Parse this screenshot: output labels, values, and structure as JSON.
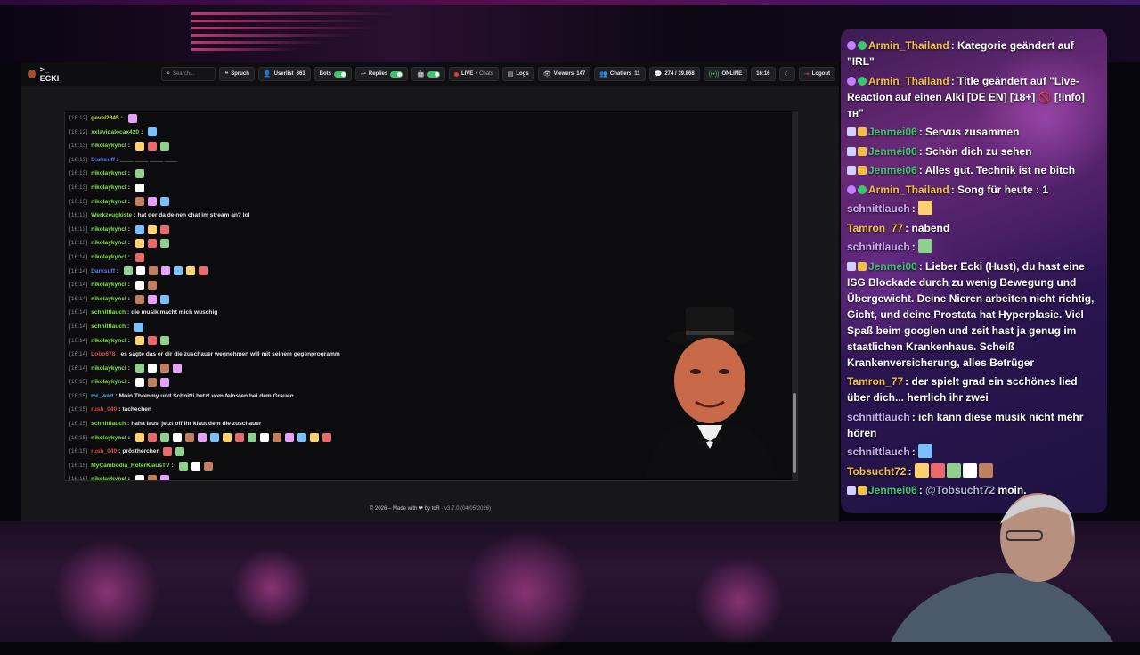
{
  "app": {
    "brand": ">_ ECKI",
    "search_placeholder": "Search...",
    "toolbar": [
      {
        "icon": "quote-icon",
        "label": "Spruch",
        "value": ""
      },
      {
        "icon": "user-icon",
        "label": "Userlist",
        "value": "363"
      },
      {
        "icon": "",
        "label": "Bots",
        "value": "",
        "toggle": true
      },
      {
        "icon": "reply-icon",
        "label": "Replies",
        "value": "",
        "toggle": true
      },
      {
        "icon": "bot-icon",
        "label": "",
        "value": "",
        "toggle": true
      },
      {
        "icon": "live-dot",
        "label": "LIVE",
        "value": "• Chats"
      },
      {
        "icon": "logs-icon",
        "label": "Logs",
        "value": ""
      },
      {
        "icon": "eye-icon",
        "label": "Viewers",
        "value": "147"
      },
      {
        "icon": "users-icon",
        "label": "Chatters",
        "value": "11"
      },
      {
        "icon": "chat-icon",
        "label": "274 / 39.868",
        "value": ""
      },
      {
        "icon": "signal-icon",
        "label": "ONLINE",
        "value": ""
      },
      {
        "icon": "",
        "label": "16:16",
        "value": ""
      },
      {
        "icon": "moon-icon",
        "label": "",
        "value": ""
      },
      {
        "icon": "logout-icon",
        "label": "Logout",
        "value": ""
      }
    ],
    "log": [
      {
        "time": "[16:12]",
        "user": "gevel2345",
        "color": "#c0e04a",
        "text": "",
        "emotes": 1
      },
      {
        "time": "[16:12]",
        "user": "xxlavidalocax420",
        "color": "#7ee24a",
        "text": "",
        "emotes": 1
      },
      {
        "time": "[16:13]",
        "user": "nikolaykyncl",
        "color": "#7ee24a",
        "text": "",
        "emotes": 3
      },
      {
        "time": "[16:13]",
        "user": "Darksuff",
        "color": "#5b7cf0",
        "text": "____ ____ ____ ____",
        "emotes": 0
      },
      {
        "time": "[16:13]",
        "user": "nikolaykyncl",
        "color": "#7ee24a",
        "text": "",
        "emotes": 1
      },
      {
        "time": "[16:13]",
        "user": "nikolaykyncl",
        "color": "#7ee24a",
        "text": "",
        "emotes": 1
      },
      {
        "time": "[16:13]",
        "user": "nikolaykyncl",
        "color": "#7ee24a",
        "text": "",
        "emotes": 3
      },
      {
        "time": "[16:13]",
        "user": "Werkzeugkiste",
        "color": "#7ee24a",
        "text": "hat der da deinen chat im stream an? lol",
        "emotes": 0
      },
      {
        "time": "[16:13]",
        "user": "nikolaykyncl",
        "color": "#7ee24a",
        "text": "",
        "emotes": 3
      },
      {
        "time": "[16:13]",
        "user": "nikolaykyncl",
        "color": "#7ee24a",
        "text": "",
        "emotes": 3
      },
      {
        "time": "[16:14]",
        "user": "nikolaykyncl",
        "color": "#7ee24a",
        "text": "",
        "emotes": 1
      },
      {
        "time": "[16:14]",
        "user": "Darksuff",
        "color": "#5b7cf0",
        "text": "",
        "emotes": 7
      },
      {
        "time": "[16:14]",
        "user": "nikolaykyncl",
        "color": "#7ee24a",
        "text": "",
        "emotes": 2
      },
      {
        "time": "[16:14]",
        "user": "nikolaykyncl",
        "color": "#7ee24a",
        "text": "",
        "emotes": 3
      },
      {
        "time": "[16:14]",
        "user": "schnittlauch",
        "color": "#7ee24a",
        "text": "die musik macht mich wuschig",
        "emotes": 0
      },
      {
        "time": "[16:14]",
        "user": "schnittlauch",
        "color": "#7ee24a",
        "text": "",
        "emotes": 1
      },
      {
        "time": "[16:14]",
        "user": "nikolaykyncl",
        "color": "#7ee24a",
        "text": "",
        "emotes": 3
      },
      {
        "time": "[16:14]",
        "user": "Lobo678",
        "color": "#e04a4a",
        "text": "es sagte das er dir die zuschauer wegnehmen will mit seinem gegenprogramm",
        "emotes": 0
      },
      {
        "time": "[16:14]",
        "user": "nikolaykyncl",
        "color": "#7ee24a",
        "text": "",
        "emotes": 4
      },
      {
        "time": "[16:15]",
        "user": "nikolaykyncl",
        "color": "#7ee24a",
        "text": "",
        "emotes": 3
      },
      {
        "time": "[16:15]",
        "user": "mr_watt",
        "color": "#5ab0e8",
        "text": "Moin Thommy und Schnitti hetzt vom feinsten bei dem Grauen",
        "emotes": 0
      },
      {
        "time": "[16:15]",
        "user": "rush_040",
        "color": "#e04a4a",
        "text": "tachechen",
        "emotes": 0
      },
      {
        "time": "[16:15]",
        "user": "schnittlauch",
        "color": "#7ee24a",
        "text": "haha lausi jetzt off ihr klaut dem die zuschauer",
        "emotes": 0
      },
      {
        "time": "[16:15]",
        "user": "nikolaykyncl",
        "color": "#7ee24a",
        "text": "",
        "emotes": 16
      },
      {
        "time": "[16:15]",
        "user": "rush_040",
        "color": "#e04a4a",
        "text": "pröstherchen",
        "emotes": 2
      },
      {
        "time": "[16:15]",
        "user": "MyCambodia_RoterKlausTV",
        "color": "#7ee24a",
        "text": "",
        "emotes": 3
      },
      {
        "time": "[16:16]",
        "user": "nikolaykyncl",
        "color": "#7ee24a",
        "text": "",
        "emotes": 3
      }
    ],
    "footer_text": "© 2026 – Made with ❤ by tcR",
    "footer_version": "· v3.7.0 (04/05/2026)"
  },
  "chat": [
    {
      "user": "Armin_Thailand",
      "color": "#f0c040",
      "badges": [
        "mic",
        "check"
      ],
      "text": "Kategorie geändert auf \"IRL\""
    },
    {
      "user": "Armin_Thailand",
      "color": "#f0c040",
      "badges": [
        "mic",
        "check"
      ],
      "text": "Title geändert auf \"Live-Reaction auf einen Alki [DE EN] [18+] 🚫 [!info] ᴛʜ\""
    },
    {
      "user": "Jenmei06",
      "color": "#3ec46d",
      "badges": [
        "flag",
        "crown"
      ],
      "text": "Servus zusammen"
    },
    {
      "user": "Jenmei06",
      "color": "#3ec46d",
      "badges": [
        "flag",
        "crown"
      ],
      "text": "Schön dich zu sehen"
    },
    {
      "user": "Jenmei06",
      "color": "#3ec46d",
      "badges": [
        "flag",
        "crown"
      ],
      "text": "Alles gut. Technik ist ne bitch"
    },
    {
      "user": "Armin_Thailand",
      "color": "#f0c040",
      "badges": [
        "mic",
        "check"
      ],
      "text": "Song für heute : 1"
    },
    {
      "user": "schnittlauch",
      "color": "#c8b0f0",
      "badges": [],
      "text": "",
      "emotes": 1
    },
    {
      "user": "Tamron_77",
      "color": "#f0c040",
      "badges": [],
      "text": "nabend"
    },
    {
      "user": "schnittlauch",
      "color": "#c8b0f0",
      "badges": [],
      "text": "",
      "emotes": 1
    },
    {
      "user": "Jenmei06",
      "color": "#3ec46d",
      "badges": [
        "flag",
        "crown"
      ],
      "text": "Lieber Ecki (Hust), du hast eine ISG Blockade durch zu wenig Bewegung und Übergewicht. Deine Nieren arbeiten nicht richtig, Gicht, und deine Prostata hat Hyperplasie. Viel Spaß beim googlen und zeit hast ja genug im staatlichen Krankenhaus. Scheiß Krankenversicherung, alles Betrüger"
    },
    {
      "user": "Tamron_77",
      "color": "#f0c040",
      "badges": [],
      "text": "der spielt grad ein scchönes lied über dich... herrlich ihr zwei"
    },
    {
      "user": "schnittlauch",
      "color": "#c8b0f0",
      "badges": [],
      "text": "ich kann diese musik nicht mehr hören"
    },
    {
      "user": "schnittlauch",
      "color": "#c8b0f0",
      "badges": [],
      "text": "",
      "emotes": 1
    },
    {
      "user": "Tobsucht72",
      "color": "#f0c040",
      "badges": [],
      "text": "",
      "emotes": 5
    },
    {
      "user": "Jenmei06",
      "color": "#3ec46d",
      "badges": [
        "flag",
        "crown"
      ],
      "text": "moin.",
      "mention": "@Tobsucht72"
    }
  ]
}
